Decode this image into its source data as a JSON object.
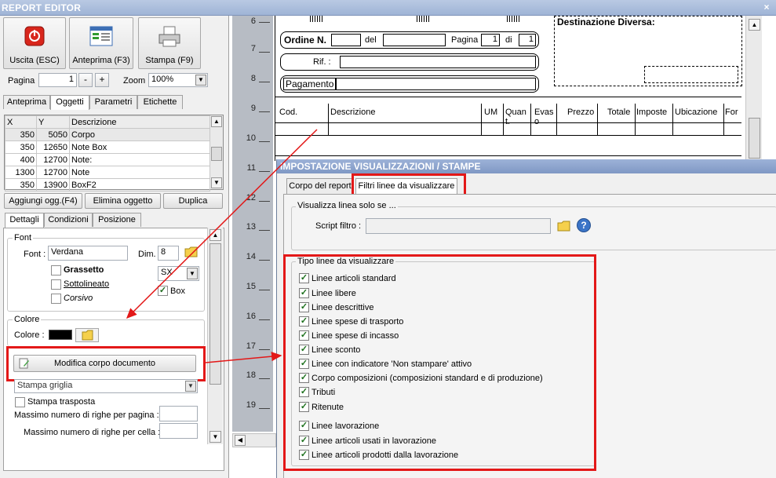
{
  "window": {
    "title": "REPORT EDITOR",
    "close_glyph": "×"
  },
  "toolbar": {
    "exit_label": "Uscita (ESC)",
    "preview_label": "Anteprima (F3)",
    "print_label": "Stampa (F9)"
  },
  "paging": {
    "page_label": "Pagina",
    "page_value": "1",
    "zoom_label": "Zoom",
    "zoom_value": "100%"
  },
  "main_tabs": [
    "Anteprima",
    "Oggetti",
    "Parametri",
    "Etichette"
  ],
  "objects_grid": {
    "headers": [
      "X",
      "Y",
      "Descrizione"
    ],
    "rows": [
      [
        "350",
        "5050",
        "Corpo"
      ],
      [
        "350",
        "12650",
        "Note Box"
      ],
      [
        "400",
        "12700",
        "Note:"
      ],
      [
        "1300",
        "12700",
        "Note"
      ],
      [
        "350",
        "13900",
        "BoxF2"
      ]
    ]
  },
  "object_buttons": {
    "add": "Aggiungi ogg.(F4)",
    "delete": "Elimina oggetto",
    "duplicate": "Duplica"
  },
  "sub_tabs": [
    "Dettagli",
    "Condizioni",
    "Posizione"
  ],
  "font_group": {
    "title": "Font",
    "font_label": "Font :",
    "font_value": "Verdana",
    "dim_label": "Dim.",
    "dim_value": "8",
    "bold_label": "Grassetto",
    "underline_label": "Sottolineato",
    "italic_label": "Corsivo",
    "align_value": "SX",
    "box_label": "Box"
  },
  "color_group": {
    "title": "Colore",
    "color_label": "Colore :"
  },
  "edit_body_button": "Modifica corpo documento",
  "print_grid_value": "Stampa griglia",
  "transposed_label": "Stampa trasposta",
  "max_rows_page_label": "Massimo numero di righe per pagina :",
  "max_rows_cell_label": "Massimo numero di righe per cella :",
  "document": {
    "ruler_labels": [
      "6",
      "7",
      "8",
      "9",
      "10",
      "11",
      "12",
      "13",
      "14",
      "15",
      "16",
      "17",
      "18",
      "19"
    ],
    "order_label": "Ordine N.",
    "del_label": "del",
    "page_label": "Pagina",
    "page_num": "1",
    "di_label": "di",
    "page_total": "1",
    "rif_label": "Rif. :",
    "payment_label": "Pagamento",
    "destination_label": "Destinazione Diversa:",
    "columns": [
      "Cod.",
      "Descrizione",
      "UM",
      "Quan t.",
      "Evas o",
      "Prezzo",
      "Totale",
      "Imposte",
      "Ubicazione",
      "For"
    ]
  },
  "dialog": {
    "title": "IMPOSTAZIONE VISUALIZZAZIONI / STAMPE",
    "tabs": [
      "Corpo del report",
      "Filtri linee da visualizzare"
    ],
    "filter_group_title": "Visualizza linea solo se ...",
    "script_label": "Script filtro :",
    "script_value": "",
    "types_group_title": "Tipo linee da visualizzare",
    "items": [
      "Linee articoli standard",
      "Linee libere",
      "Linee descrittive",
      "Linee spese di trasporto",
      "Linee spese di incasso",
      "Linee sconto",
      "Linee con indicatore 'Non stampare' attivo",
      "Corpo composizioni (composizioni standard e di produzione)",
      "Tributi",
      "Ritenute",
      "Linee lavorazione",
      "Linee articoli usati in lavorazione",
      "Linee articoli prodotti dalla lavorazione"
    ]
  },
  "colors": {
    "accent_red": "#e31818",
    "title_blue": "#8ea6cf"
  }
}
